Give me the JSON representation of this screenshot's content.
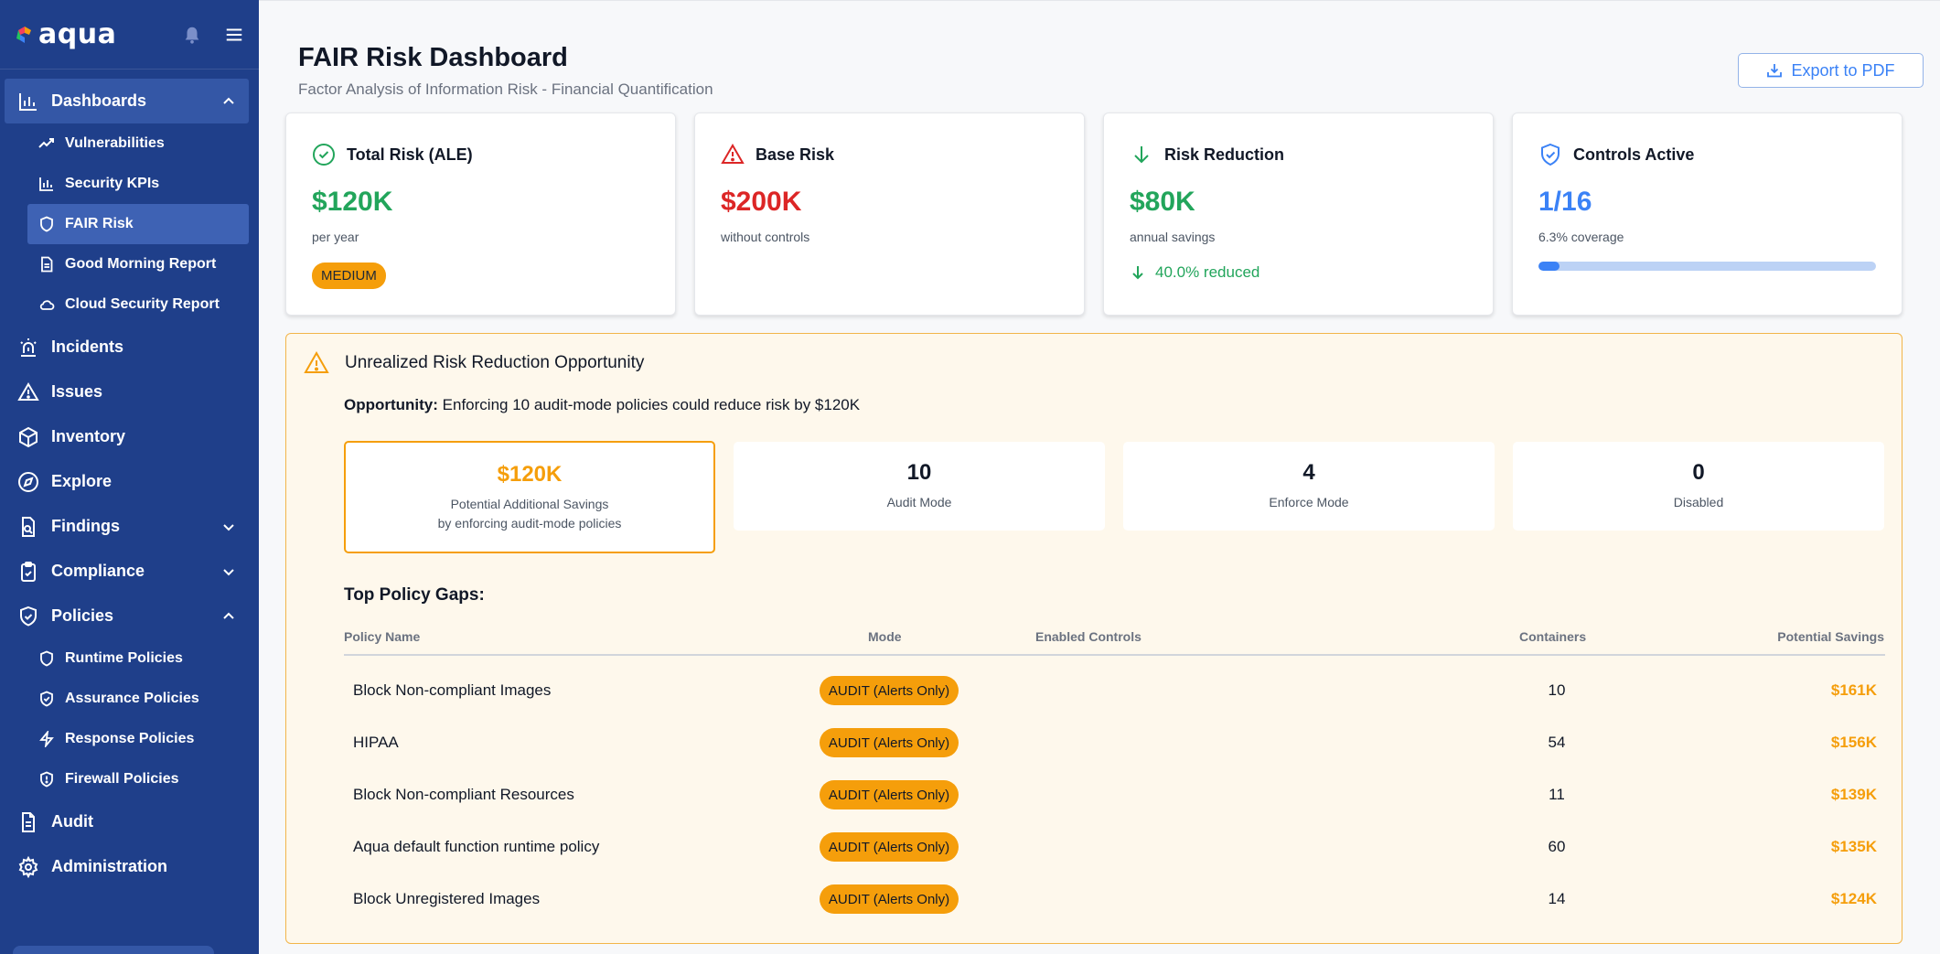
{
  "brand": {
    "name": "aqua"
  },
  "nav": {
    "dashboards": "Dashboards",
    "dashboards_items": [
      "Vulnerabilities",
      "Security KPIs",
      "FAIR Risk",
      "Good Morning Report",
      "Cloud Security Report"
    ],
    "incidents": "Incidents",
    "issues": "Issues",
    "inventory": "Inventory",
    "explore": "Explore",
    "findings": "Findings",
    "compliance": "Compliance",
    "policies": "Policies",
    "policies_items": [
      "Runtime Policies",
      "Assurance Policies",
      "Response Policies",
      "Firewall Policies"
    ],
    "audit": "Audit",
    "administration": "Administration"
  },
  "header": {
    "title": "FAIR Risk Dashboard",
    "subtitle": "Factor Analysis of Information Risk - Financial Quantification",
    "export_label": "Export to PDF"
  },
  "cards": {
    "total": {
      "title": "Total Risk (ALE)",
      "value": "$120K",
      "sub": "per year",
      "badge": "MEDIUM"
    },
    "base": {
      "title": "Base Risk",
      "value": "$200K",
      "sub": "without controls"
    },
    "reduction": {
      "title": "Risk Reduction",
      "value": "$80K",
      "sub": "annual savings",
      "reduced": "40.0% reduced"
    },
    "controls": {
      "title": "Controls Active",
      "value": "1/16",
      "sub": "6.3% coverage",
      "coverage": 0.063
    }
  },
  "opportunity": {
    "title": "Unrealized Risk Reduction Opportunity",
    "lead": "Opportunity:",
    "text": "Enforcing 10 audit-mode policies could reduce risk by $120K",
    "savings_value": "$120K",
    "savings_label_1": "Potential Additional Savings",
    "savings_label_2": "by enforcing audit-mode policies",
    "audit_value": "10",
    "audit_label": "Audit Mode",
    "enforce_value": "4",
    "enforce_label": "Enforce Mode",
    "disabled_value": "0",
    "disabled_label": "Disabled"
  },
  "gaps": {
    "title": "Top Policy Gaps:",
    "columns": {
      "name": "Policy Name",
      "mode": "Mode",
      "controls": "Enabled Controls",
      "containers": "Containers",
      "savings": "Potential Savings"
    },
    "rows": [
      {
        "name": "Block Non-compliant Images",
        "mode": "AUDIT (Alerts Only)",
        "containers": "10",
        "savings": "$161K"
      },
      {
        "name": "HIPAA",
        "mode": "AUDIT (Alerts Only)",
        "containers": "54",
        "savings": "$156K"
      },
      {
        "name": "Block Non-compliant Resources",
        "mode": "AUDIT (Alerts Only)",
        "containers": "11",
        "savings": "$139K"
      },
      {
        "name": "Aqua default function runtime policy",
        "mode": "AUDIT (Alerts Only)",
        "containers": "60",
        "savings": "$135K"
      },
      {
        "name": "Block Unregistered Images",
        "mode": "AUDIT (Alerts Only)",
        "containers": "14",
        "savings": "$124K"
      }
    ]
  },
  "colors": {
    "sidebar": "#1f3f8a",
    "green": "#22a55b",
    "red": "#dc2626",
    "blue": "#3b82f6",
    "orange": "#f59e0b"
  }
}
